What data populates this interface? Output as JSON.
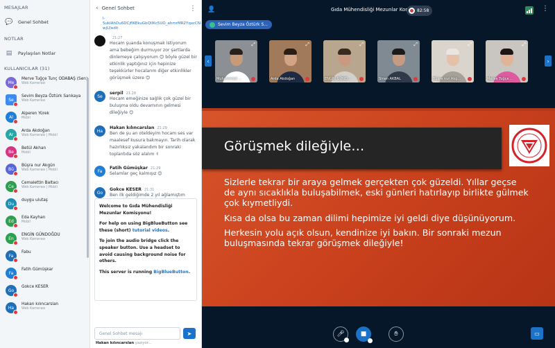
{
  "left": {
    "messages_title": "MESAJLAR",
    "public_chat": "Genel Sohbet",
    "notes_title": "NOTLAR",
    "shared_notes": "Paylaşılan Notlar",
    "users_title": "KULLANICILAR (31)",
    "users": [
      {
        "initials": "Me",
        "name": "Merve Tuğçe Tunç ODABAŞ (Sen)",
        "sub": "Web Kamerası",
        "color": "#7b6ad9",
        "square": false
      },
      {
        "initials": "Se",
        "name": "Sevim Beyza Öztürk Sarıkaya",
        "sub": "Web Kamerası",
        "color": "#3c8cf0",
        "square": true
      },
      {
        "initials": "Al",
        "name": "Alperen Yürek",
        "sub": "Mobil",
        "color": "#1f7ed6",
        "square": false
      },
      {
        "initials": "Ar",
        "name": "Arda Akdoğan",
        "sub": "Web Kamerası | Mobil",
        "color": "#27a6a6",
        "square": false
      },
      {
        "initials": "Be",
        "name": "Betül Akhan",
        "sub": "Mobil",
        "color": "#d63384",
        "square": false
      },
      {
        "initials": "Bü",
        "name": "Büşra nur Akgün",
        "sub": "Web Kamerası | Mobil",
        "color": "#5b66d6",
        "square": false
      },
      {
        "initials": "Ce",
        "name": "Cemalettin Baltacı",
        "sub": "Web Kamerası | Mobil",
        "color": "#2e9e4f",
        "square": false
      },
      {
        "initials": "Du",
        "name": "duygu ulutaş",
        "sub": "",
        "color": "#1f8fb0",
        "square": false
      },
      {
        "initials": "Ed",
        "name": "Eda Kayhan",
        "sub": "Mobil",
        "color": "#2e9e4f",
        "square": false
      },
      {
        "initials": "En",
        "name": "ENGİN GÜNDOĞDU",
        "sub": "Web Kamerası",
        "color": "#2e9e4f",
        "square": false
      },
      {
        "initials": "Fa",
        "name": "Fabu",
        "sub": "",
        "color": "#1f6fb8",
        "square": false
      },
      {
        "initials": "Fa",
        "name": "Fatih Gümüşkar",
        "sub": "",
        "color": "#1f7ed6",
        "square": false
      },
      {
        "initials": "Go",
        "name": "Gokce KESER",
        "sub": "",
        "color": "#1f6fb8",
        "square": false
      },
      {
        "initials": "Ha",
        "name": "Hakan kılıncarslan",
        "sub": "Web Kamerası",
        "color": "#1f6fb8",
        "square": false
      }
    ]
  },
  "chat": {
    "title": "Genel Sohbet",
    "link_text": "l-5ukIAhDu6DCjflKEkuGbQIIKc5UO_ahmrMR2YqxcCN-wjU/edit",
    "messages": [
      {
        "initials": "",
        "name": "",
        "time": "21:27",
        "color": "#111111",
        "text": "Hocam şuanda konuşmak istiyorum ama bebeğim durmuyor zor şartlarda dinlemeye çalışıyorum 😊 böyle güzel bir etkinlik yaptığınız için hepinize teşekkürler hocalarım diğer etkinlikler görüşmek üzere 😊"
      },
      {
        "initials": "Se",
        "name": "serpil",
        "time": "21:28",
        "color": "#1f6fb8",
        "text": "Hocam emeğinize sağlık çok güzel bir buluşma oldu devamının gelmesi dileğiyle 😊"
      },
      {
        "initials": "Ha",
        "name": "Hakan kılıncarslan",
        "time": "21:29",
        "color": "#1f6fb8",
        "text": "Ben de şu an oteldeyim hocam ses var maalesef kusura bakmayın. Tarih olarak hazırlıksız yakalandım bir sonraki toplantıda söz alalım ✌"
      },
      {
        "initials": "Fa",
        "name": "Fatih Gümüşkar",
        "time": "21:29",
        "color": "#1f7ed6",
        "text": "Selamlar geç kalmışız 😊"
      },
      {
        "initials": "Go",
        "name": "Gokce KESER",
        "time": "21:31",
        "color": "#1f6fb8",
        "text": "Ben ilk geldiğimde 2 yıl ağlamıştım hocam 😊"
      }
    ],
    "welcome": {
      "line1": "Welcome to Gıda Mühendisliği Mezunlar Komisyonu!",
      "line2a": "For help on using BigBlueButton see these (short) ",
      "line2b": "tutorial videos",
      "line2c": ".",
      "line3": "To join the audio bridge click the speaker button. Use a headset to avoid causing background noise for others.",
      "line4a": "This server is running ",
      "line4b": "BigBlueButton",
      "line4c": "."
    },
    "input_placeholder": "Genel Sohbet mesajı",
    "typing_name": "Hakan kılıncarslan",
    "typing_suffix": " yazıyor..."
  },
  "main": {
    "meeting_title": "Gıda Mühendisliği Mezunlar Komisyonu",
    "record_time": "82:58",
    "presenter_pill": "Sevim Beyza Öztürk S...",
    "tiles": [
      {
        "label": "Muhammed ...",
        "bg": "#8c8f93",
        "skin": "#c79a7a",
        "hair": "#2a201a",
        "shirt": "#ffffff"
      },
      {
        "label": "Arda Akdoğan",
        "bg": "#a07a5a",
        "skin": "#d2a384",
        "hair": "#2b1d14",
        "shirt": "#1c2a44"
      },
      {
        "label": "ENGİN GÜND...",
        "bg": "#b9a68e",
        "skin": "#c99a7f",
        "hair": "#3a2a1f",
        "shirt": "#d2d0cc"
      },
      {
        "label": "Sinan AKBAL",
        "bg": "#7f8a93",
        "skin": "#c69b82",
        "hair": "#1f1a17",
        "shirt": "#2e3a4a"
      },
      {
        "label": "Büşra nur Akg...",
        "bg": "#d9d4cc",
        "skin": "#e4c1a8",
        "hair": "#e9e6e1",
        "shirt": "#a5a09a"
      },
      {
        "label": "Merve Tuğçe ...",
        "bg": "#c9c6c2",
        "skin": "#e1b49a",
        "hair": "#1f1612",
        "shirt": "#e05aa2"
      }
    ],
    "slide": {
      "title": "Görüşmek dileğiyle…",
      "p1": "Sizlerle tekrar bir araya gelmek gerçekten çok güzeldi. Yıllar geçse de aynı sıcaklıkla buluşabilmek, eski günleri hatırlayıp birlikte gülmek çok kıymetliydi.",
      "p2": "Kısa da olsa bu zaman dilimi hepimize iyi geldi diye düşünüyorum.",
      "p3": "Herkesin yolu açık olsun, kendinize iyi bakın. Bir sonraki mezun buluşmasında tekrar görüşmek dileğiyle!"
    }
  }
}
